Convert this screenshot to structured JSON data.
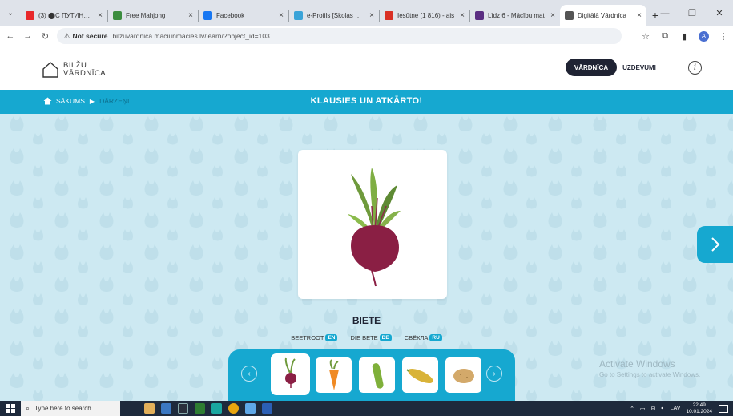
{
  "browser": {
    "tabs": [
      {
        "title": "(3) ⬤С ПУТИНЫМ ·",
        "favicon_color": "#e8282b",
        "active": false
      },
      {
        "title": "Free Mahjong",
        "favicon_color": "#3c8d3f",
        "active": false
      },
      {
        "title": "Facebook",
        "favicon_color": "#1877f2",
        "active": false
      },
      {
        "title": "e-Profils [Skolas adm",
        "favicon_color": "#3aa3d8",
        "active": false
      },
      {
        "title": "Iesūtne (1 816) - ais",
        "favicon_color": "#d93025",
        "active": false
      },
      {
        "title": "Līdz 6 - Mācību mat",
        "favicon_color": "#5a2d82",
        "active": false
      },
      {
        "title": "Digitālā Vārdnīca",
        "favicon_color": "#555555",
        "active": true
      }
    ],
    "new_tab": "+",
    "address": {
      "warning": "Not secure",
      "url": "bilzuvardnica.maciunmacies.lv/learn/?object_id=103"
    }
  },
  "app": {
    "logo_line1": "BILŽU",
    "logo_line2": "VĀRDNĪCA",
    "nav_dictionary": "VĀRDNĪCA",
    "nav_tasks": "UZDEVUMI",
    "info": "i",
    "breadcrumb_home": "SĀKUMS",
    "breadcrumb_current": "DĀRZEŅI",
    "instruction": "KLAUSIES UN ATKĀRTO!",
    "word": "BIETE",
    "translations": [
      {
        "text": "BEETROOT",
        "lang": "EN"
      },
      {
        "text": "DIE BETE",
        "lang": "DE"
      },
      {
        "text": "СВЁКЛА",
        "lang": "RU"
      }
    ],
    "accent_color": "#16a8d0",
    "thumbnails": [
      {
        "icon": "beetroot-icon",
        "active": true
      },
      {
        "icon": "carrot-icon",
        "active": false
      },
      {
        "icon": "cucumber-icon",
        "active": false
      },
      {
        "icon": "zucchini-icon",
        "active": false
      },
      {
        "icon": "potato-icon",
        "active": false
      }
    ]
  },
  "watermark": {
    "line1": "Activate Windows",
    "line2": "Go to Settings to activate Windows."
  },
  "taskbar": {
    "search_placeholder": "Type here to search",
    "language": "LAV",
    "time": "22:49",
    "date": "10.01.2024"
  }
}
